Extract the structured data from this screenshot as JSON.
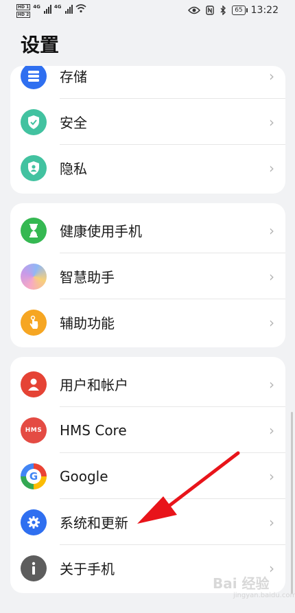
{
  "status_bar": {
    "hd1": "HD 1",
    "hd2": "HD 2",
    "net1": "4G",
    "net2": "4G",
    "battery": "65",
    "time": "13:22"
  },
  "header": {
    "title": "设置"
  },
  "groups": [
    {
      "items": [
        {
          "label": "存储",
          "icon": "storage-icon",
          "color": "#2f6ff0"
        },
        {
          "label": "安全",
          "icon": "security-shield-icon",
          "color": "#42c2a0"
        },
        {
          "label": "隐私",
          "icon": "privacy-icon",
          "color": "#42c2a0"
        }
      ]
    },
    {
      "items": [
        {
          "label": "健康使用手机",
          "icon": "hourglass-icon",
          "color": "#35b852"
        },
        {
          "label": "智慧助手",
          "icon": "assistant-icon",
          "color": "#c99ae8"
        },
        {
          "label": "辅助功能",
          "icon": "accessibility-hand-icon",
          "color": "#f6a623"
        }
      ]
    },
    {
      "items": [
        {
          "label": "用户和帐户",
          "icon": "user-icon",
          "color": "#e54335"
        },
        {
          "label": "HMS Core",
          "icon": "hms-icon",
          "color": "#e44b43"
        },
        {
          "label": "Google",
          "icon": "google-icon",
          "color": "#4285f4"
        },
        {
          "label": "系统和更新",
          "icon": "gear-icon",
          "color": "#2f6ff0"
        },
        {
          "label": "关于手机",
          "icon": "info-icon",
          "color": "#5d5d5d"
        }
      ]
    }
  ],
  "hms_text": "HMS",
  "watermark": "Bai 经验",
  "watermark_sub": "jingyan.baidu.com"
}
